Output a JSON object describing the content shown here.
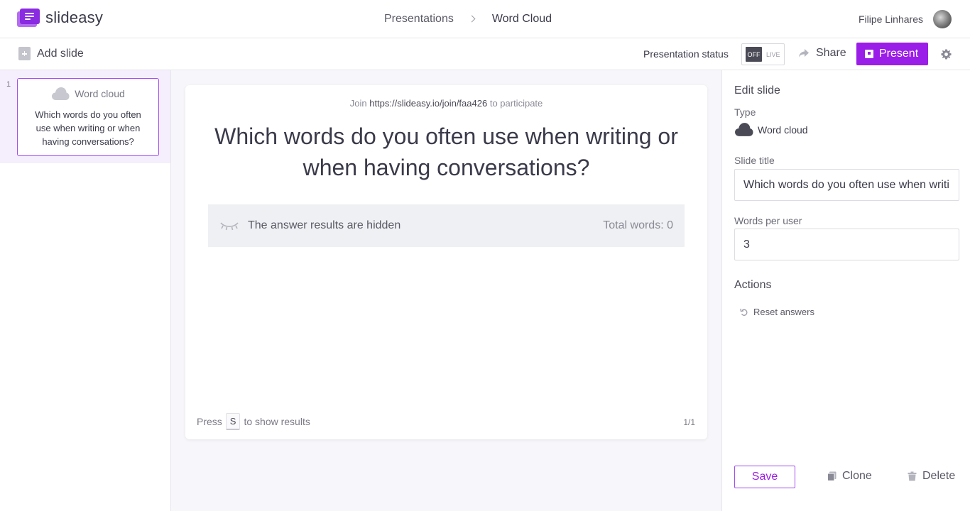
{
  "app": {
    "name": "slideasy"
  },
  "breadcrumb": {
    "parent": "Presentations",
    "current": "Word Cloud"
  },
  "user": {
    "name": "Filipe Linhares"
  },
  "toolbar": {
    "add_slide": "Add slide",
    "status_label": "Presentation status",
    "toggle_off": "OFF",
    "toggle_live": "LIVE",
    "share": "Share",
    "present": "Present"
  },
  "slides": [
    {
      "number": "1",
      "type": "Word cloud",
      "text": "Which words do you often use when writing or when having conversations?"
    }
  ],
  "slide": {
    "join_prefix": "Join",
    "join_url": "https://slideasy.io/join/faa426",
    "join_suffix": "to participate",
    "question": "Which words do you often use when writing or when having conversations?",
    "hidden_message": "The answer results are hidden",
    "total_words": "Total words: 0",
    "press_prefix": "Press",
    "press_key": "S",
    "press_suffix": "to show results",
    "pager": "1/1"
  },
  "edit_panel": {
    "title": "Edit slide",
    "type_label": "Type",
    "type_value": "Word cloud",
    "slide_title_label": "Slide title",
    "slide_title_value": "Which words do you often use when writing or when having conversations?",
    "words_per_user_label": "Words per user",
    "words_per_user_value": "3",
    "actions_title": "Actions",
    "reset_answers": "Reset answers",
    "save": "Save",
    "clone": "Clone",
    "delete": "Delete"
  },
  "colors": {
    "accent": "#9b1de8",
    "accent_light": "#f5eefc",
    "canvas_bg": "#f7f6fa"
  },
  "icons": {
    "logo": "slideasy-logo-icon",
    "cloud": "cloud-icon",
    "share": "share-arrow-icon",
    "present": "present-screen-icon",
    "settings": "gear-icon",
    "hidden": "closed-eye-icon",
    "reset": "undo-icon",
    "clone": "copy-icon",
    "delete": "trash-icon"
  }
}
